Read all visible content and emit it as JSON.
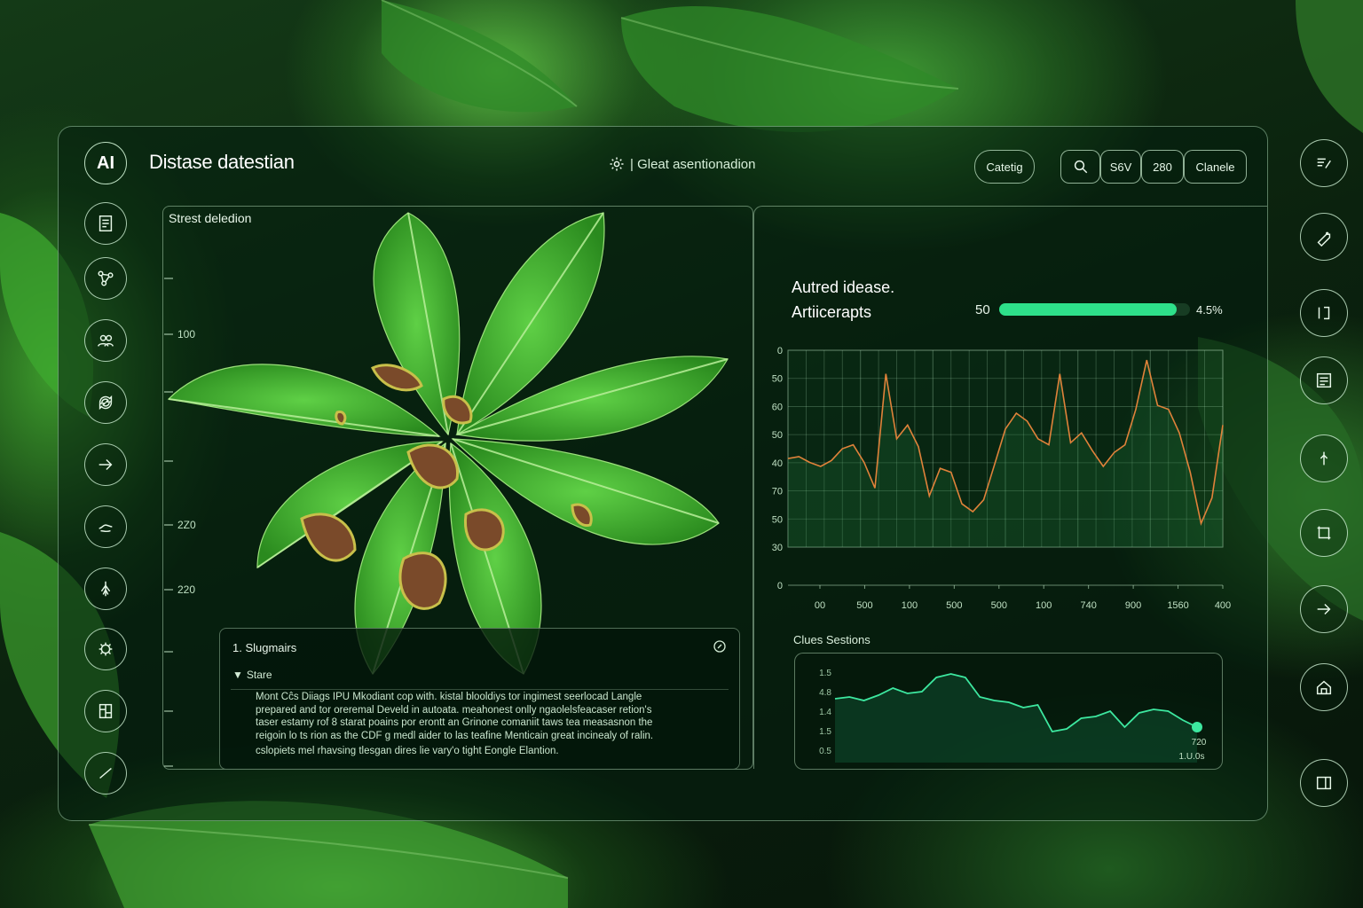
{
  "app": {
    "logo": "AI",
    "title": "Distase datestian"
  },
  "header": {
    "status_icon": "gear-icon",
    "status_text": "| Gleat asentionadion",
    "buttons": {
      "category": "Catetig",
      "search_icon": "search-icon",
      "sov": "S6V",
      "count": "280",
      "cancel": "Clanele"
    }
  },
  "left_rail": [
    "document-icon",
    "network-icon",
    "users-icon",
    "sync-icon",
    "arrow-right-icon",
    "hand-icon",
    "tree-icon",
    "bug-icon",
    "panels-icon",
    "check-icon"
  ],
  "right_rail": [
    "list-edit-icon",
    "tag-icon",
    "split-icon",
    "report-icon",
    "compass-icon",
    "crop-icon",
    "arrow-right-icon",
    "home-icon",
    "layout-icon"
  ],
  "image_panel": {
    "label": "Strest deledion",
    "ticks": [
      "100",
      "2Z0",
      "220"
    ]
  },
  "summary": {
    "title": "1. Slugmairs",
    "subtitle": "Stare",
    "lines": [
      "Mont Cĉs Diiags IPU Mkodiant cop with. kistal blooldiys tor ingimest seerlocad Langle",
      "prepared and tor oreremal Develd in autoata. meahonest onlly ngaolelsfeacaser retion's",
      "taser estamy rof 8 starat poains por erontt an Grinone comaniit taws tea measasnon the",
      "reigoin lo ts rion as the CDF g medl aider to las teafine Menticain great incinealy of ralin."
    ],
    "last_line": "cslopiets mel rhavsing tlesgan dires lie vary'o tight Eongle Elantion."
  },
  "metric": {
    "title_line1": "Autred idease.",
    "title_line2": "Artiicerapts",
    "start_label": "50",
    "progress": 0.93,
    "percent_label": "4.5%"
  },
  "chart_data": [
    {
      "type": "line",
      "y_tick_labels": [
        "0",
        "50",
        "60",
        "50",
        "40",
        "70",
        "50",
        "30",
        "0"
      ],
      "x_tick_labels": [
        "00",
        "500",
        "100",
        "500",
        "500",
        "100",
        "740",
        "900",
        "1560",
        "400"
      ],
      "series": [
        {
          "color": "#e0823a",
          "values": [
            45,
            46,
            43,
            41,
            44,
            50,
            52,
            43,
            30,
            88,
            55,
            62,
            51,
            26,
            40,
            38,
            22,
            18,
            24,
            42,
            60,
            68,
            64,
            55,
            52,
            88,
            53,
            58,
            49,
            41,
            48,
            52,
            70,
            95,
            72,
            70,
            58,
            38,
            12,
            25,
            62
          ]
        }
      ],
      "grid": true
    },
    {
      "type": "area",
      "title": "Clues Sestions",
      "y_tick_labels": [
        "1.5",
        "4.8",
        "1.4",
        "1.5",
        "0.5"
      ],
      "series": [
        {
          "color": "#3de8a0",
          "values": [
            0.62,
            0.64,
            0.6,
            0.66,
            0.74,
            0.68,
            0.7,
            0.86,
            0.9,
            0.86,
            0.64,
            0.6,
            0.58,
            0.52,
            0.55,
            0.25,
            0.28,
            0.4,
            0.42,
            0.48,
            0.3,
            0.46,
            0.5,
            0.48,
            0.38,
            0.3
          ]
        }
      ],
      "end_labels": [
        "720",
        "1.U.0s"
      ]
    }
  ]
}
